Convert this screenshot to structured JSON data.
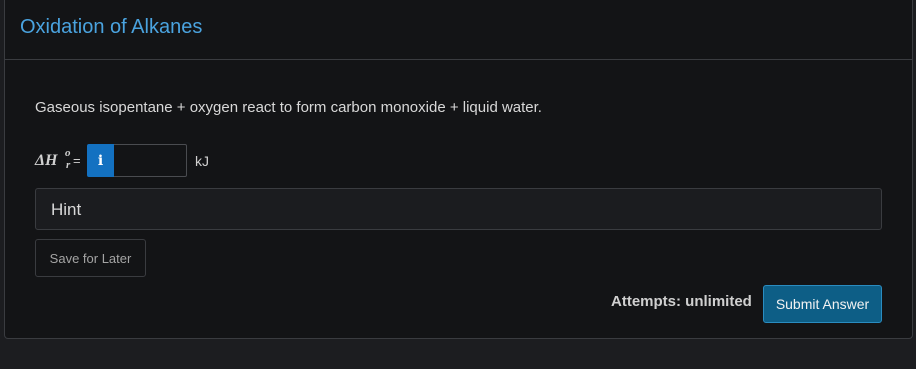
{
  "header": {
    "title": "Oxidation of Alkanes"
  },
  "question": {
    "text": "Gaseous isopentane + oxygen react to form carbon monoxide + liquid water."
  },
  "answer": {
    "symbol_main": "ΔH",
    "symbol_sup": "o",
    "symbol_sub": "r",
    "equals": "=",
    "info_icon_glyph": "i",
    "info_icon": "info-icon",
    "input_value": "",
    "unit": "kJ"
  },
  "hint": {
    "label": "Hint"
  },
  "actions": {
    "save_label": "Save for Later",
    "attempts_text": "Attempts: unlimited",
    "submit_label": "Submit Answer"
  },
  "colors": {
    "page_bg": "#1c1d20",
    "card_bg": "#131416",
    "title": "#4aa3df",
    "info_button": "#1371c1",
    "submit_button": "#0d5e86",
    "border": "#3a3c40"
  }
}
